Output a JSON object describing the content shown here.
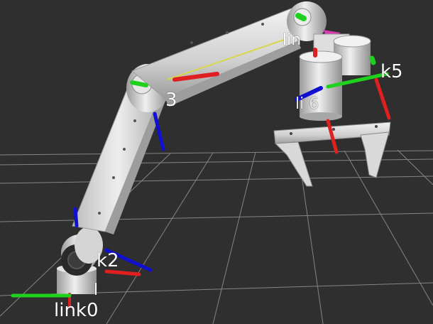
{
  "viewer": {
    "title": "",
    "background_color": "#2f2f2f",
    "grid_color": "#9a9a9a"
  },
  "robot": {
    "labels": {
      "link0": "link0",
      "link1": "l",
      "link2": "k2",
      "link3": "3",
      "link4": "lin",
      "link5": "k5",
      "link6": "li   6"
    },
    "colors": {
      "body": "#d9d9d9",
      "shadow": "#8e8e8e",
      "joint_dark": "#2a2a2a",
      "cable": "#d8d84a",
      "accent_magenta": "#d43cb0"
    }
  },
  "axes": {
    "x_color": "#e02020",
    "y_color": "#1fd01f",
    "z_color": "#1010d0"
  }
}
